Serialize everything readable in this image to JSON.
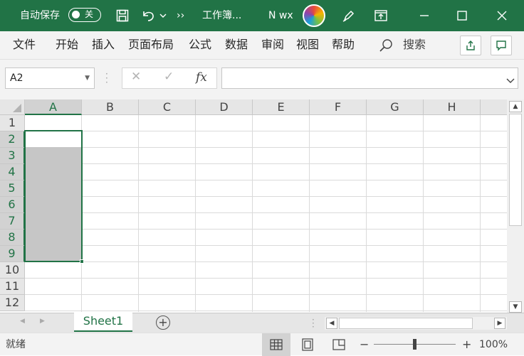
{
  "titlebar": {
    "autosave_label": "自动保存",
    "autosave_state": "关",
    "more": "››",
    "doc_title": "工作簿...",
    "user": "N wx",
    "icons": [
      "save-icon",
      "undo-icon",
      "chevron-down-icon",
      "pen-icon",
      "restore-ribbon-icon",
      "minimize-icon",
      "maximize-icon",
      "close-icon"
    ]
  },
  "menu": {
    "items": [
      "文件",
      "开始",
      "插入",
      "页面布局",
      "公式",
      "数据",
      "审阅",
      "视图",
      "帮助"
    ],
    "search": "搜索"
  },
  "formula": {
    "name_box": "A2",
    "cancel": "✕",
    "enter": "✓",
    "fx": "fx",
    "value": ""
  },
  "grid": {
    "columns": [
      "A",
      "B",
      "C",
      "D",
      "E",
      "F",
      "G",
      "H"
    ],
    "rows": [
      "1",
      "2",
      "3",
      "4",
      "5",
      "6",
      "7",
      "8",
      "9",
      "10",
      "11",
      "12"
    ],
    "selected_column": "A",
    "selected_rows": [
      "2",
      "3",
      "4",
      "5",
      "6",
      "7",
      "8",
      "9"
    ],
    "active_cell": "A2",
    "selection_range": "A2:A9"
  },
  "sheets": {
    "tabs": [
      "Sheet1"
    ],
    "add": "+"
  },
  "status": {
    "ready": "就绪",
    "zoom_minus": "−",
    "zoom_plus": "+",
    "zoom": "100%"
  },
  "colors": {
    "brand": "#217346",
    "selection_fill": "#c6c6c6"
  }
}
